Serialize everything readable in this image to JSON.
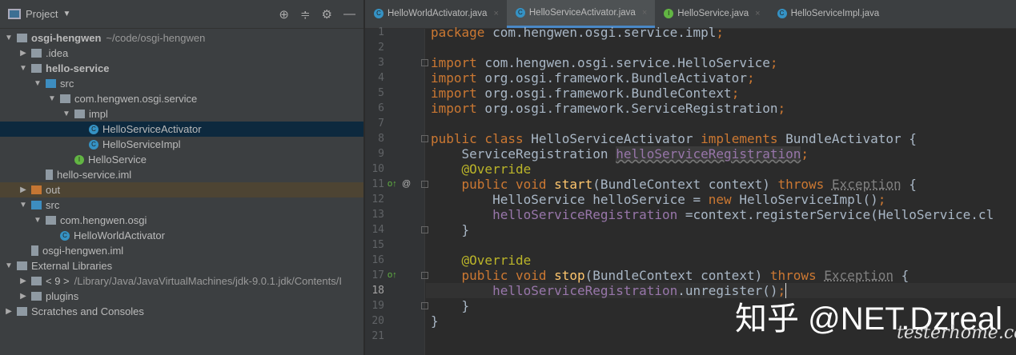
{
  "project": {
    "title": "Project"
  },
  "tree": [
    {
      "label": "osgi-hengwen",
      "suffix": "~/code/osgi-hengwen",
      "depth": 0,
      "arrow": "down",
      "icon": "folder",
      "bold": true
    },
    {
      "label": ".idea",
      "depth": 1,
      "arrow": "right",
      "icon": "folder"
    },
    {
      "label": "hello-service",
      "depth": 1,
      "arrow": "down",
      "icon": "folder",
      "bold": true
    },
    {
      "label": "src",
      "depth": 2,
      "arrow": "down",
      "icon": "src"
    },
    {
      "label": "com.hengwen.osgi.service",
      "depth": 3,
      "arrow": "down",
      "icon": "pkg"
    },
    {
      "label": "impl",
      "depth": 4,
      "arrow": "down",
      "icon": "pkg"
    },
    {
      "label": "HelloServiceActivator",
      "depth": 5,
      "icon": "class",
      "selected": true
    },
    {
      "label": "HelloServiceImpl",
      "depth": 5,
      "icon": "class"
    },
    {
      "label": "HelloService",
      "depth": 4,
      "icon": "iface"
    },
    {
      "label": "hello-service.iml",
      "depth": 2,
      "icon": "file"
    },
    {
      "label": "out",
      "depth": 1,
      "arrow": "right",
      "icon": "out",
      "outrow": true
    },
    {
      "label": "src",
      "depth": 1,
      "arrow": "down",
      "icon": "src"
    },
    {
      "label": "com.hengwen.osgi",
      "depth": 2,
      "arrow": "down",
      "icon": "pkg"
    },
    {
      "label": "HelloWorldActivator",
      "depth": 3,
      "icon": "class"
    },
    {
      "label": "osgi-hengwen.iml",
      "depth": 1,
      "icon": "file"
    },
    {
      "label": "External Libraries",
      "depth": 0,
      "arrow": "down",
      "icon": "lib"
    },
    {
      "label": "< 9 >",
      "suffix": "/Library/Java/JavaVirtualMachines/jdk-9.0.1.jdk/Contents/I",
      "depth": 1,
      "arrow": "right",
      "icon": "folder"
    },
    {
      "label": "plugins",
      "depth": 1,
      "arrow": "right",
      "icon": "lib"
    },
    {
      "label": "Scratches and Consoles",
      "depth": 0,
      "arrow": "right",
      "icon": "folder"
    }
  ],
  "tabs": [
    {
      "label": "HelloWorldActivator.java",
      "icon": "class"
    },
    {
      "label": "HelloServiceActivator.java",
      "icon": "class",
      "active": true
    },
    {
      "label": "HelloService.java",
      "icon": "iface"
    },
    {
      "label": "HelloServiceImpl.java",
      "icon": "class"
    }
  ],
  "current_line": 18,
  "code": [
    [
      [
        "package",
        "kw"
      ],
      [
        " com.hengwen.osgi.service.impl",
        ""
      ],
      [
        ";",
        "kw"
      ]
    ],
    [],
    [
      [
        "import",
        "kw"
      ],
      [
        " com.hengwen.osgi.service.HelloService",
        ""
      ],
      [
        ";",
        "kw"
      ]
    ],
    [
      [
        "import",
        "kw"
      ],
      [
        " org.osgi.framework.BundleActivator",
        ""
      ],
      [
        ";",
        "kw"
      ]
    ],
    [
      [
        "import",
        "kw"
      ],
      [
        " org.osgi.framework.BundleContext",
        ""
      ],
      [
        ";",
        "kw"
      ]
    ],
    [
      [
        "import",
        "kw"
      ],
      [
        " org.osgi.framework.ServiceRegistration",
        ""
      ],
      [
        ";",
        "kw"
      ]
    ],
    [],
    [
      [
        "public class ",
        "kw"
      ],
      [
        "HelloServiceActivator ",
        ""
      ],
      [
        "implements ",
        "kw"
      ],
      [
        "BundleActivator {",
        ""
      ]
    ],
    [
      [
        "    ServiceRegistration ",
        ""
      ],
      [
        "helloServiceRegistration",
        "hl"
      ],
      [
        ";",
        "kw"
      ]
    ],
    [
      [
        "    ",
        ""
      ],
      [
        "@Override",
        "an"
      ]
    ],
    [
      [
        "    ",
        ""
      ],
      [
        "public void ",
        "kw"
      ],
      [
        "start",
        "fn"
      ],
      [
        "(BundleContext context) ",
        ""
      ],
      [
        "throws ",
        "kw"
      ],
      [
        "Exception",
        "ex"
      ],
      [
        " {",
        ""
      ]
    ],
    [
      [
        "        HelloService helloService = ",
        ""
      ],
      [
        "new ",
        "kw"
      ],
      [
        "HelloServiceImpl()",
        ""
      ],
      [
        ";",
        "kw"
      ]
    ],
    [
      [
        "        ",
        ""
      ],
      [
        "helloServiceRegistration",
        "fd"
      ],
      [
        " =context.registerService(HelloService.cl",
        ""
      ]
    ],
    [
      [
        "    }",
        ""
      ]
    ],
    [],
    [
      [
        "    ",
        ""
      ],
      [
        "@Override",
        "an"
      ]
    ],
    [
      [
        "    ",
        ""
      ],
      [
        "public void ",
        "kw"
      ],
      [
        "stop",
        "fn"
      ],
      [
        "(BundleContext context) ",
        ""
      ],
      [
        "throws ",
        "kw"
      ],
      [
        "Exception",
        "ex"
      ],
      [
        " {",
        ""
      ]
    ],
    [
      [
        "        ",
        ""
      ],
      [
        "helloServiceRegistration",
        "fd"
      ],
      [
        ".unregister()",
        ""
      ],
      [
        ";",
        "kw"
      ]
    ],
    [
      [
        "    }",
        ""
      ]
    ],
    [
      [
        "}",
        ""
      ]
    ],
    []
  ],
  "watermark": {
    "text": "知乎 @NET.Dzreal",
    "site": "testerhome.com"
  }
}
